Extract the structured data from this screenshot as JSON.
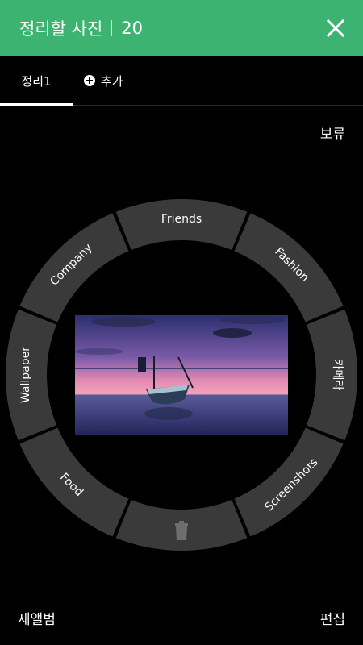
{
  "header": {
    "title": "정리할 사진",
    "count": "20",
    "close_icon": "close-icon",
    "background": "#3cb371"
  },
  "tabs": [
    {
      "label": "정리1",
      "active": true
    },
    {
      "label": "추가",
      "icon": "add-circle-icon",
      "active": false
    }
  ],
  "actions": {
    "hold": "보류",
    "new_album": "새앨범",
    "edit": "편집"
  },
  "wheel": {
    "segments": [
      {
        "label": "Friends"
      },
      {
        "label": "Fashion"
      },
      {
        "label": "카메라"
      },
      {
        "label": "Screenshots"
      },
      {
        "label": "",
        "icon": "trash-icon"
      },
      {
        "label": "Food"
      },
      {
        "label": "Wallpaper"
      },
      {
        "label": "Company"
      }
    ],
    "segment_color": "#3a3a3a"
  },
  "photo": {
    "subject": "boat on lake at sunset"
  }
}
